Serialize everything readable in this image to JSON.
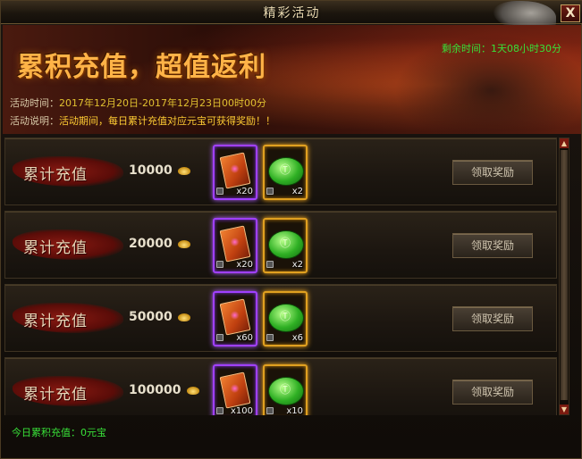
{
  "window": {
    "title": "精彩活动",
    "close_label": "X"
  },
  "banner": {
    "title": "累积充值，超值返利",
    "countdown": "剩余时间：1天08小时30分",
    "time_label": "活动时间：",
    "time_value": "2017年12月20日-2017年12月23日00时00分",
    "desc_label": "活动说明：",
    "desc_value": "活动期间，每日累计充值对应元宝可获得奖励！！"
  },
  "rows": [
    {
      "label": "累计充值",
      "amount": "10000",
      "item1_qty": "x20",
      "item2_qty": "x2",
      "button": "领取奖励"
    },
    {
      "label": "累计充值",
      "amount": "20000",
      "item1_qty": "x20",
      "item2_qty": "x2",
      "button": "领取奖励"
    },
    {
      "label": "累计充值",
      "amount": "50000",
      "item1_qty": "x60",
      "item2_qty": "x6",
      "button": "领取奖励"
    },
    {
      "label": "累计充值",
      "amount": "100000",
      "item1_qty": "x100",
      "item2_qty": "x10",
      "button": "领取奖励"
    }
  ],
  "footer": {
    "today_total": "今日累积充值：0元宝"
  },
  "icons": {
    "close": "close-icon",
    "currency": "gold-ingot-icon",
    "item1": "ticket-icon",
    "item2": "green-gem-icon",
    "lock": "lock-icon",
    "scroll_up": "scroll-up-arrow-icon",
    "scroll_down": "scroll-down-arrow-icon"
  },
  "colors": {
    "countdown": "#38e038",
    "time_value": "#e0c030",
    "desc_value": "#ffcc33",
    "banner_title": "#ffb347",
    "item_frame_purple": "#a040ff",
    "item_frame_gold": "#e0a020"
  }
}
